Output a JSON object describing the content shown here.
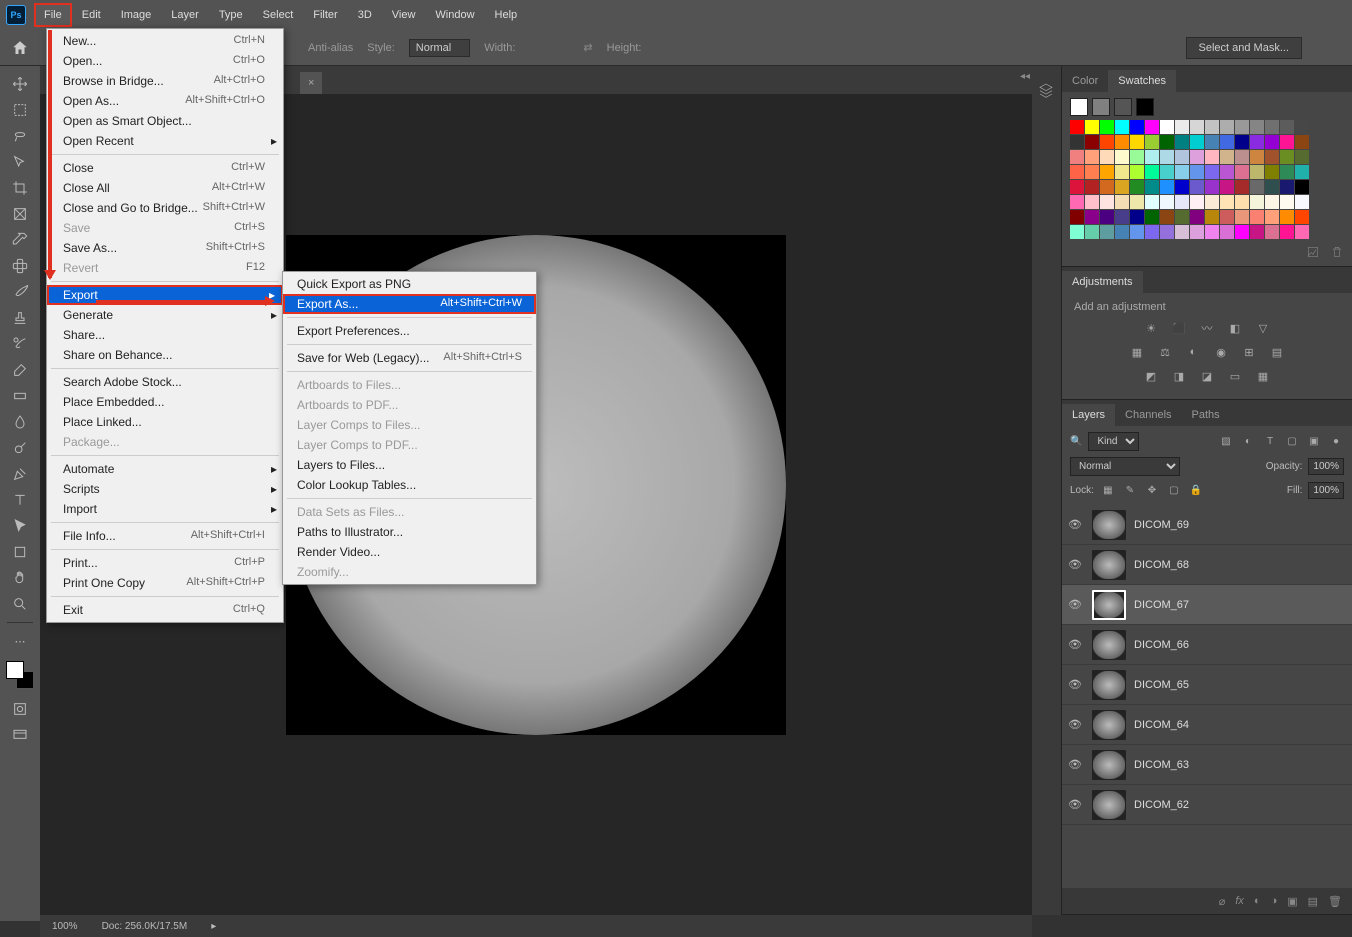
{
  "menubar": [
    "File",
    "Edit",
    "Image",
    "Layer",
    "Type",
    "Select",
    "Filter",
    "3D",
    "View",
    "Window",
    "Help"
  ],
  "active_menu": "File",
  "optionsbar": {
    "anti_alias": "Anti-alias",
    "style_label": "Style:",
    "style_value": "Normal",
    "width_label": "Width:",
    "height_label": "Height:",
    "select_mask": "Select and Mask..."
  },
  "file_menu": [
    {
      "label": "New...",
      "shortcut": "Ctrl+N"
    },
    {
      "label": "Open...",
      "shortcut": "Ctrl+O"
    },
    {
      "label": "Browse in Bridge...",
      "shortcut": "Alt+Ctrl+O"
    },
    {
      "label": "Open As...",
      "shortcut": "Alt+Shift+Ctrl+O"
    },
    {
      "label": "Open as Smart Object..."
    },
    {
      "label": "Open Recent",
      "submenu": true
    },
    {
      "sep": true
    },
    {
      "label": "Close",
      "shortcut": "Ctrl+W"
    },
    {
      "label": "Close All",
      "shortcut": "Alt+Ctrl+W"
    },
    {
      "label": "Close and Go to Bridge...",
      "shortcut": "Shift+Ctrl+W"
    },
    {
      "label": "Save",
      "shortcut": "Ctrl+S",
      "disabled": true
    },
    {
      "label": "Save As...",
      "shortcut": "Shift+Ctrl+S"
    },
    {
      "label": "Revert",
      "shortcut": "F12",
      "disabled": true
    },
    {
      "sep": true
    },
    {
      "label": "Export",
      "submenu": true,
      "highlighted": true
    },
    {
      "label": "Generate",
      "submenu": true
    },
    {
      "label": "Share..."
    },
    {
      "label": "Share on Behance..."
    },
    {
      "sep": true
    },
    {
      "label": "Search Adobe Stock..."
    },
    {
      "label": "Place Embedded..."
    },
    {
      "label": "Place Linked..."
    },
    {
      "label": "Package...",
      "disabled": true
    },
    {
      "sep": true
    },
    {
      "label": "Automate",
      "submenu": true
    },
    {
      "label": "Scripts",
      "submenu": true
    },
    {
      "label": "Import",
      "submenu": true
    },
    {
      "sep": true
    },
    {
      "label": "File Info...",
      "shortcut": "Alt+Shift+Ctrl+I"
    },
    {
      "sep": true
    },
    {
      "label": "Print...",
      "shortcut": "Ctrl+P"
    },
    {
      "label": "Print One Copy",
      "shortcut": "Alt+Shift+Ctrl+P"
    },
    {
      "sep": true
    },
    {
      "label": "Exit",
      "shortcut": "Ctrl+Q"
    }
  ],
  "export_submenu": [
    {
      "label": "Quick Export as PNG"
    },
    {
      "label": "Export As...",
      "shortcut": "Alt+Shift+Ctrl+W",
      "highlighted": true
    },
    {
      "sep": true
    },
    {
      "label": "Export Preferences..."
    },
    {
      "sep": true
    },
    {
      "label": "Save for Web (Legacy)...",
      "shortcut": "Alt+Shift+Ctrl+S"
    },
    {
      "sep": true
    },
    {
      "label": "Artboards to Files...",
      "disabled": true
    },
    {
      "label": "Artboards to PDF...",
      "disabled": true
    },
    {
      "label": "Layer Comps to Files...",
      "disabled": true
    },
    {
      "label": "Layer Comps to PDF...",
      "disabled": true
    },
    {
      "label": "Layers to Files..."
    },
    {
      "label": "Color Lookup Tables..."
    },
    {
      "sep": true
    },
    {
      "label": "Data Sets as Files...",
      "disabled": true
    },
    {
      "label": "Paths to Illustrator..."
    },
    {
      "label": "Render Video..."
    },
    {
      "label": "Zoomify...",
      "disabled": true
    }
  ],
  "panels": {
    "color_tab": "Color",
    "swatches_tab": "Swatches",
    "adjustments_tab": "Adjustments",
    "adjustments_label": "Add an adjustment",
    "layers_tab": "Layers",
    "channels_tab": "Channels",
    "paths_tab": "Paths"
  },
  "layers_panel": {
    "kind": "Kind",
    "blend": "Normal",
    "opacity_label": "Opacity:",
    "opacity_value": "100%",
    "lock_label": "Lock:",
    "fill_label": "Fill:",
    "fill_value": "100%",
    "layers": [
      {
        "name": "DICOM_69"
      },
      {
        "name": "DICOM_68"
      },
      {
        "name": "DICOM_67",
        "selected": true
      },
      {
        "name": "DICOM_66"
      },
      {
        "name": "DICOM_65"
      },
      {
        "name": "DICOM_64"
      },
      {
        "name": "DICOM_63"
      },
      {
        "name": "DICOM_62"
      }
    ]
  },
  "status": {
    "zoom": "100%",
    "doc": "Doc: 256.0K/17.5M"
  },
  "big_swatches": [
    "#ffffff",
    "#808080",
    "#555555",
    "#000000"
  ],
  "swatches_hex": [
    "#ff0000",
    "#ffff00",
    "#00ff00",
    "#00ffff",
    "#0000ff",
    "#ff00ff",
    "#ffffff",
    "#ebebeb",
    "#d6d6d6",
    "#c2c2c2",
    "#adadad",
    "#999999",
    "#858585",
    "#707070",
    "#5c5c5c",
    "#474747",
    "#333333",
    "#8b0000",
    "#ff4500",
    "#ff8c00",
    "#ffd700",
    "#9acd32",
    "#006400",
    "#008080",
    "#00ced1",
    "#4682b4",
    "#4169e1",
    "#00008b",
    "#8a2be2",
    "#9400d3",
    "#ff1493",
    "#8b4513",
    "#f08080",
    "#ffa07a",
    "#ffdab9",
    "#fffacd",
    "#98fb98",
    "#afeeee",
    "#add8e6",
    "#b0c4de",
    "#dda0dd",
    "#ffb6c1",
    "#d2b48c",
    "#bc8f8f",
    "#cd853f",
    "#a0522d",
    "#6b8e23",
    "#556b2f",
    "#ff6347",
    "#ff7f50",
    "#ffa500",
    "#f0e68c",
    "#adff2f",
    "#00fa9a",
    "#48d1cc",
    "#87ceeb",
    "#6495ed",
    "#7b68ee",
    "#ba55d3",
    "#db7093",
    "#bdb76b",
    "#808000",
    "#2e8b57",
    "#20b2aa",
    "#dc143c",
    "#b22222",
    "#d2691e",
    "#daa520",
    "#228b22",
    "#008b8b",
    "#1e90ff",
    "#0000cd",
    "#6a5acd",
    "#9932cc",
    "#c71585",
    "#a52a2a",
    "#696969",
    "#2f4f4f",
    "#191970",
    "#000000",
    "#ff69b4",
    "#ffc0cb",
    "#ffe4e1",
    "#f5deb3",
    "#eee8aa",
    "#e0ffff",
    "#f0f8ff",
    "#e6e6fa",
    "#fff0f5",
    "#faebd7",
    "#ffe4b5",
    "#ffdead",
    "#f5f5dc",
    "#fdf5e6",
    "#fffaf0",
    "#f8f8ff",
    "#800000",
    "#8b008b",
    "#4b0082",
    "#483d8b",
    "#00008b",
    "#006400",
    "#8b4513",
    "#556b2f",
    "#800080",
    "#b8860b",
    "#cd5c5c",
    "#e9967a",
    "#fa8072",
    "#ffa07a",
    "#ff8c00",
    "#ff4500",
    "#7fffd4",
    "#66cdaa",
    "#5f9ea0",
    "#4682b4",
    "#6495ed",
    "#7b68ee",
    "#9370db",
    "#d8bfd8",
    "#dda0dd",
    "#ee82ee",
    "#da70d6",
    "#ff00ff",
    "#c71585",
    "#db7093",
    "#ff1493",
    "#ff69b4"
  ]
}
